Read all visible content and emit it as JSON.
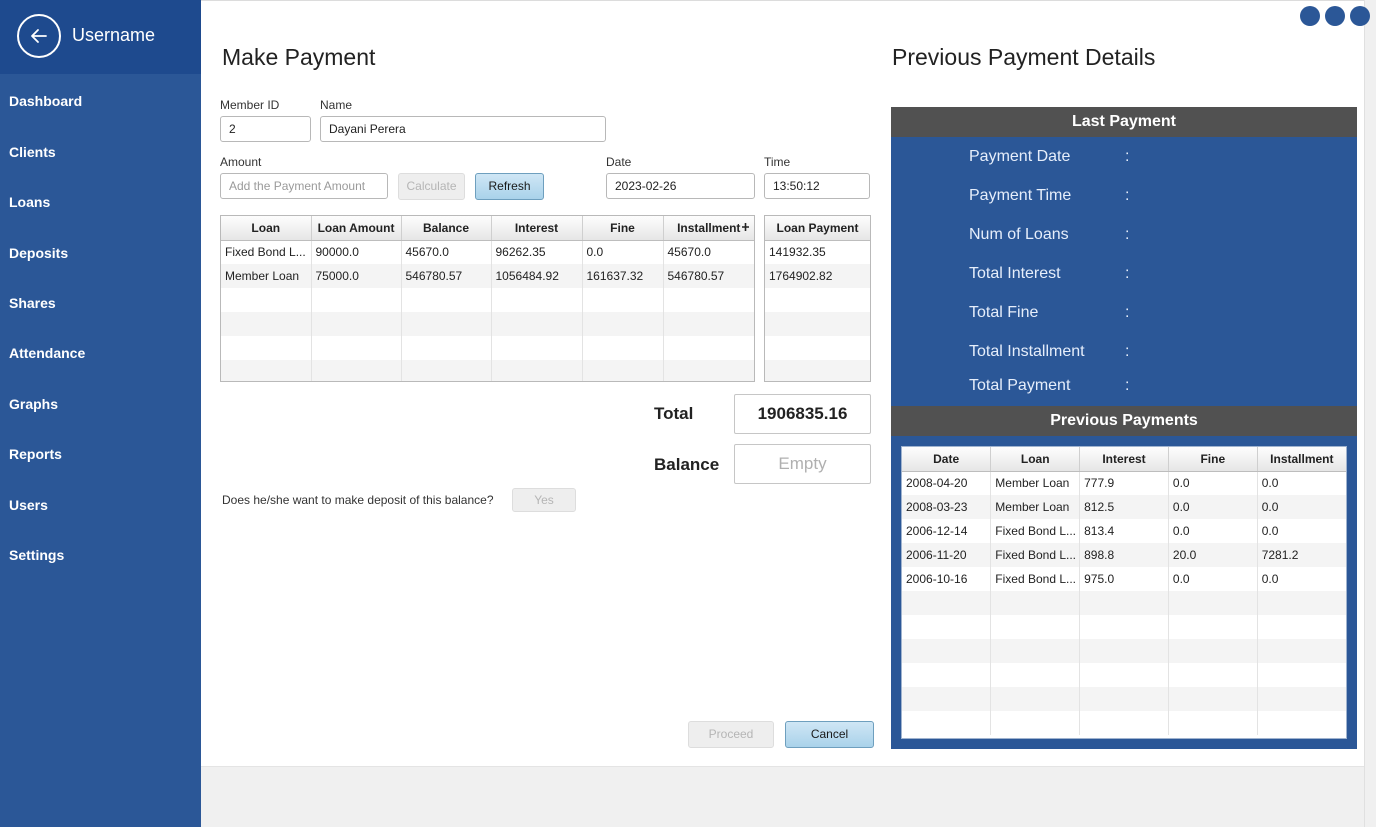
{
  "sidebar": {
    "username": "Username",
    "items": [
      "Dashboard",
      "Clients",
      "Loans",
      "Deposits",
      "Shares",
      "Attendance",
      "Graphs",
      "Reports",
      "Users",
      "Settings"
    ]
  },
  "payment": {
    "title": "Make Payment",
    "member_id_label": "Member ID",
    "member_id_value": "2",
    "name_label": "Name",
    "name_value": "Dayani Perera",
    "amount_label": "Amount",
    "amount_placeholder": "Add the Payment Amount",
    "calculate_label": "Calculate",
    "refresh_label": "Refresh",
    "date_label": "Date",
    "date_value": "2023-02-26",
    "time_label": "Time",
    "time_value": "13:50:12",
    "loans_table": {
      "columns": [
        "Loan",
        "Loan Amount",
        "Balance",
        "Interest",
        "Fine",
        "Installment"
      ],
      "rows": [
        [
          "Fixed Bond L...",
          "90000.0",
          "45670.0",
          "96262.35",
          "0.0",
          "45670.0"
        ],
        [
          "Member Loan",
          "75000.0",
          "546780.57",
          "1056484.92",
          "161637.32",
          "546780.57"
        ]
      ],
      "empty_rows": 4
    },
    "loan_payment_table": {
      "columns": [
        "Loan Payment"
      ],
      "rows": [
        [
          "141932.35"
        ],
        [
          "1764902.82"
        ]
      ],
      "empty_rows": 4
    },
    "total_label": "Total",
    "total_value": "1906835.16",
    "balance_label": "Balance",
    "balance_value": "Empty",
    "deposit_question": "Does he/she want to make deposit of this balance?",
    "yes_label": "Yes",
    "proceed_label": "Proceed",
    "cancel_label": "Cancel"
  },
  "previous": {
    "title": "Previous Payment Details",
    "last_payment_header": "Last Payment",
    "last_payment_fields": [
      "Payment Date",
      "Payment Time",
      "Num of Loans",
      "Total Interest",
      "Total Fine",
      "Total Installment",
      "Total Payment"
    ],
    "colon": ":",
    "previous_payments_header": "Previous Payments",
    "table": {
      "columns": [
        "Date",
        "Loan",
        "Interest",
        "Fine",
        "Installment"
      ],
      "rows": [
        [
          "2008-04-20",
          "Member Loan",
          "777.9",
          "0.0",
          "0.0"
        ],
        [
          "2008-03-23",
          "Member Loan",
          "812.5",
          "0.0",
          "0.0"
        ],
        [
          "2006-12-14",
          "Fixed Bond L...",
          "813.4",
          "0.0",
          "0.0"
        ],
        [
          "2006-11-20",
          "Fixed Bond L...",
          "898.8",
          "20.0",
          "7281.2"
        ],
        [
          "2006-10-16",
          "Fixed Bond L...",
          "975.0",
          "0.0",
          "0.0"
        ]
      ],
      "empty_rows": 6
    }
  },
  "colors": {
    "sidebar": "#2b5797",
    "sidebar_header": "#1e4a8e",
    "panel_header": "#515151"
  }
}
